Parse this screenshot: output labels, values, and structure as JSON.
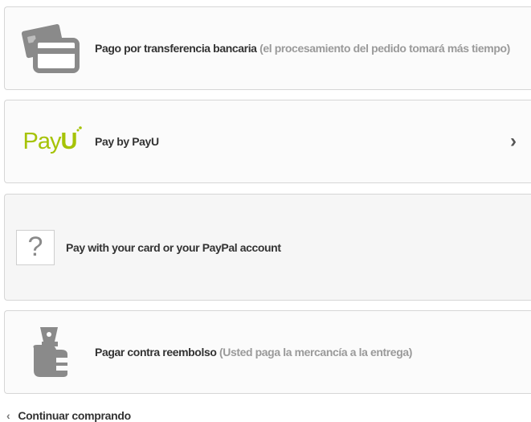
{
  "payment_options": [
    {
      "title": "Pago por transferencia bancaria",
      "note": "(el procesamiento del pedido tomará más tiempo)",
      "icon": "bank-card-icon"
    },
    {
      "title": "Pay by PayU",
      "logo_text_pay": "Pay",
      "logo_text_u": "U",
      "icon": "payu-logo",
      "chevron": "›"
    },
    {
      "title": "Pay with your card or your PayPal account",
      "icon_glyph": "?",
      "icon": "question-mark-icon"
    },
    {
      "title": "Pagar contra reembolso",
      "note": "(Usted paga la mercancía a la entrega)",
      "icon": "cash-hand-icon"
    }
  ],
  "back_link": {
    "arrow": "‹",
    "label": "Continuar comprando"
  },
  "colors": {
    "payu_green": "#a6c307",
    "icon_gray": "#8a8a8a",
    "border": "#d6d6d6"
  }
}
